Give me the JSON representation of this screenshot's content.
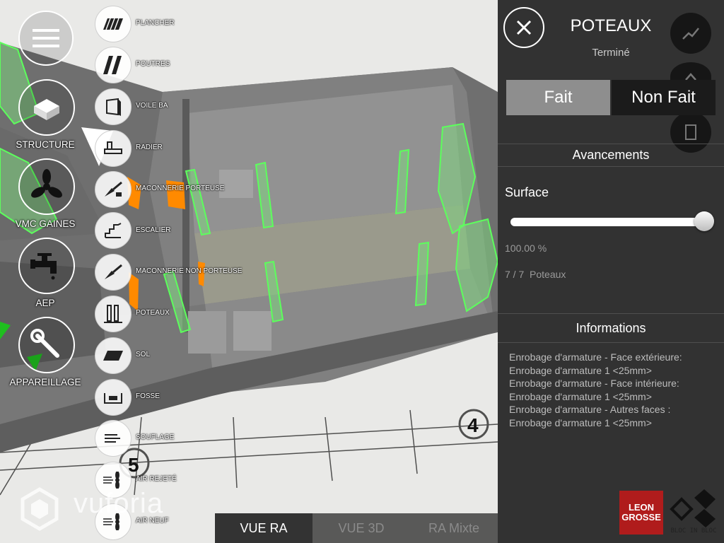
{
  "categories": [
    {
      "label": "STRUCTURE",
      "icon": "structure-icon"
    },
    {
      "label": "VMC GAINES",
      "icon": "fan-icon"
    },
    {
      "label": "AEP",
      "icon": "faucet-icon"
    },
    {
      "label": "APPAREILLAGE",
      "icon": "wrench-icon"
    }
  ],
  "sub_items": [
    {
      "label": "PLANCHER",
      "icon": "floor-slab-icon"
    },
    {
      "label": "POUTRES",
      "icon": "beam-icon"
    },
    {
      "label": "VOILE BA",
      "icon": "wall-icon"
    },
    {
      "label": "RADIER",
      "icon": "raft-icon"
    },
    {
      "label": "MACONNERIE PORTEUSE",
      "icon": "trowel-icon"
    },
    {
      "label": "ESCALIER",
      "icon": "stairs-icon"
    },
    {
      "label": "MACONNERIE NON PORTEUSE",
      "icon": "trowel-icon"
    },
    {
      "label": "POTEAUX",
      "icon": "column-icon"
    },
    {
      "label": "SOL",
      "icon": "ground-icon"
    },
    {
      "label": "FOSSE",
      "icon": "pit-icon"
    },
    {
      "label": "SOUFLAGE",
      "icon": "blowing-icon"
    },
    {
      "label": "AIR REJETÉ",
      "icon": "air-out-icon"
    },
    {
      "label": "AIR NEUF",
      "icon": "air-in-icon"
    }
  ],
  "watermark": "vuforia",
  "view_tabs": [
    {
      "label": "VUE RA",
      "active": true
    },
    {
      "label": "VUE 3D",
      "active": false
    },
    {
      "label": "RA Mixte",
      "active": false
    }
  ],
  "panel": {
    "title": "POTEAUX",
    "status": "Terminé",
    "toggle": {
      "done_label": "Fait",
      "not_done_label": "Non Fait",
      "selected": "done"
    },
    "progress_header": "Avancements",
    "surface_label": "Surface",
    "surface_value_fraction": 1.0,
    "percent_text": "100.00 %",
    "count_text": "7 / 7",
    "count_unit": "Poteaux",
    "info_header": "Informations",
    "info_lines": [
      "Enrobage d'armature - Face extérieure:",
      "Enrobage d'armature 1 <25mm>",
      "Enrobage d'armature - Face intérieure:",
      "Enrobage d'armature 1 <25mm>",
      "Enrobage d'armature - Autres faces :",
      "Enrobage d'armature 1 <25mm>"
    ]
  },
  "logos": {
    "leon_grosse": "LEON GROSSE",
    "bloc_in_bloc": "BLOC IN BLOC"
  },
  "colors": {
    "panel_bg": "#141414",
    "highlight_green": "#4cff4c",
    "orange": "#ff8a00",
    "red_logo": "#b01c1c"
  }
}
